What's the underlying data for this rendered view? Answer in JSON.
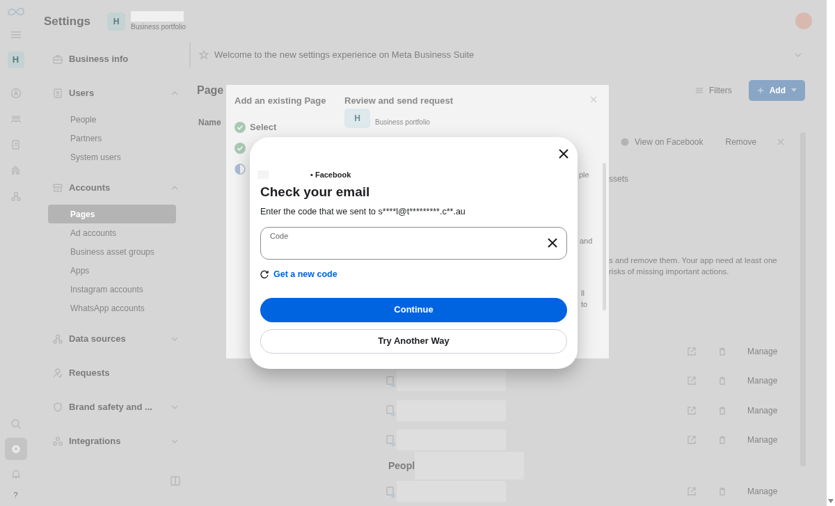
{
  "header": {
    "title": "Settings",
    "portfolio_initial": "H",
    "portfolio_subtitle": "Business portfolio"
  },
  "rail": {
    "avatar_initial": "H",
    "items": [
      {
        "selected": false
      },
      {
        "selected": false
      },
      {
        "selected": false
      },
      {
        "selected": false
      },
      {
        "selected": false
      }
    ],
    "bottom": [
      {
        "kind": "search",
        "selected": false
      },
      {
        "kind": "settings",
        "selected": true
      },
      {
        "kind": "bell",
        "selected": false
      }
    ],
    "help": "?"
  },
  "sidebar": [
    {
      "label": "Business info"
    },
    {
      "label": "Users",
      "expanded": true,
      "children": [
        {
          "label": "People",
          "selected": false
        },
        {
          "label": "Partners",
          "selected": false
        },
        {
          "label": "System users",
          "selected": false
        }
      ]
    },
    {
      "label": "Accounts",
      "expanded": true,
      "children": [
        {
          "label": "Pages",
          "selected": true
        },
        {
          "label": "Ad accounts",
          "selected": false
        },
        {
          "label": "Business asset groups",
          "selected": false
        },
        {
          "label": "Apps",
          "selected": false
        },
        {
          "label": "Instagram accounts",
          "selected": false
        },
        {
          "label": "WhatsApp accounts",
          "selected": false
        }
      ]
    },
    {
      "label": "Data sources",
      "expanded": false
    },
    {
      "label": "Requests"
    },
    {
      "label": "Brand safety and ...",
      "expanded": false
    },
    {
      "label": "Integrations",
      "expanded": false
    }
  ],
  "banner": {
    "text": "Welcome to the new settings experience on Meta Business Suite"
  },
  "main": {
    "title": "Page",
    "filters": "Filters",
    "add": "Add",
    "column": "Name",
    "row_actions": [
      "View on Facebook",
      "Remove"
    ],
    "fragment": "ssets",
    "notice": [
      "s and remove them. Your app need at least one",
      "risks of missing important actions."
    ],
    "rows": [
      {
        "action": "Manage"
      },
      {
        "action": "Manage"
      },
      {
        "action": "Manage"
      },
      {
        "action": "Manage"
      }
    ],
    "section": "Peopl",
    "last_row": {
      "action": "Manage"
    }
  },
  "add_dialog": {
    "title": "Add an existing Page",
    "steps": [
      {
        "label": "Select",
        "completed": true
      },
      {
        "completed": true
      },
      {
        "completed": false
      }
    ],
    "heading": "Review and send request",
    "portfolio_initial": "H",
    "portfolio_subtitle": "Business portfolio",
    "fragments": [
      "ple",
      "and",
      "ll",
      "to"
    ]
  },
  "modal": {
    "source": "• Facebook",
    "title": "Check your email",
    "text": "Enter the code that we sent to s****l@t*********.c**.au",
    "field": {
      "label": "Code"
    },
    "link": "Get a new code",
    "primary": "Continue",
    "secondary": "Try Another Way"
  }
}
